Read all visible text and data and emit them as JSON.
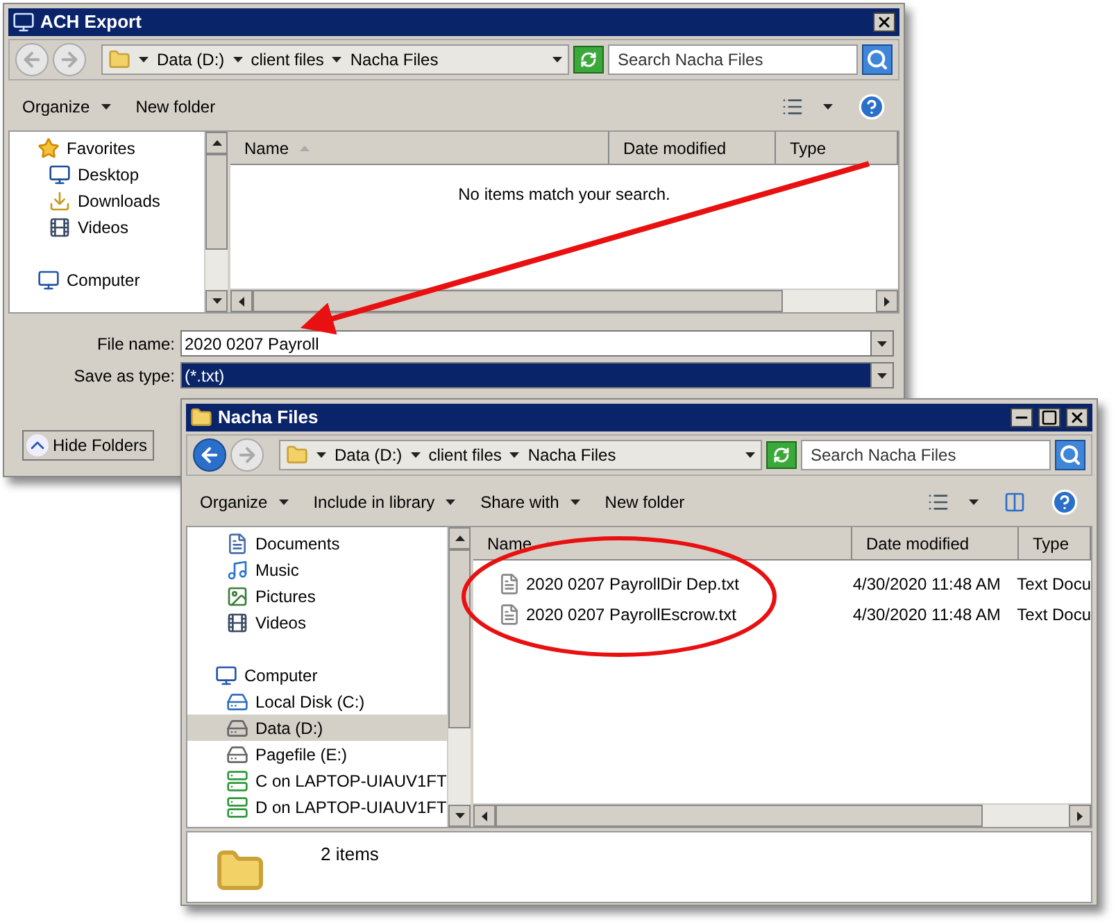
{
  "save_dialog": {
    "title": "ACH Export",
    "title_buttons": [
      {
        "kind": "close"
      }
    ],
    "back_enabled": false,
    "breadcrumb": [
      "Data (D:)",
      "client files",
      "Nacha Files"
    ],
    "search": {
      "placeholder": "Search Nacha Files"
    },
    "toolbar": [
      {
        "label": "Organize",
        "dropdown": true
      },
      {
        "label": "New folder",
        "dropdown": false
      }
    ],
    "view_buttons": [
      {
        "kind": "views"
      },
      {
        "kind": "help"
      }
    ],
    "sidebar": [
      {
        "label": "Favorites",
        "kind": "star",
        "selected": false,
        "children": [
          {
            "label": "Desktop",
            "kind": "desktop",
            "selected": false
          },
          {
            "label": "Downloads",
            "kind": "downloads",
            "selected": false
          },
          {
            "label": "Videos",
            "kind": "video",
            "selected": false
          }
        ]
      },
      {
        "label": "Computer",
        "kind": "computer",
        "selected": false
      }
    ],
    "columns": [
      {
        "label": "Name",
        "sorted": true
      },
      {
        "label": "Date modified",
        "sorted": false
      },
      {
        "label": "Type",
        "sorted": false
      }
    ],
    "empty_message": "No items match your search.",
    "file_name": {
      "label": "File name:",
      "value": "2020 0207 Payroll",
      "highlighted": false
    },
    "save_type": {
      "label": "Save as type:",
      "value": "(*.txt)",
      "highlighted": true
    },
    "hide_folders": "Hide Folders"
  },
  "explorer": {
    "title": "Nacha Files",
    "title_buttons": [
      {
        "kind": "minimize"
      },
      {
        "kind": "maximize"
      },
      {
        "kind": "close"
      }
    ],
    "back_enabled": true,
    "breadcrumb": [
      "Data (D:)",
      "client files",
      "Nacha Files"
    ],
    "search": {
      "placeholder": "Search Nacha Files"
    },
    "toolbar": [
      {
        "label": "Organize",
        "dropdown": true
      },
      {
        "label": "Include in library",
        "dropdown": true
      },
      {
        "label": "Share with",
        "dropdown": true
      },
      {
        "label": "New folder",
        "dropdown": false
      }
    ],
    "view_buttons": [
      {
        "kind": "views"
      },
      {
        "kind": "preview"
      },
      {
        "kind": "help"
      }
    ],
    "sidebar": [
      {
        "label": "Documents",
        "kind": "documents",
        "selected": false
      },
      {
        "label": "Music",
        "kind": "music",
        "selected": false
      },
      {
        "label": "Pictures",
        "kind": "pictures",
        "selected": false
      },
      {
        "label": "Videos",
        "kind": "video",
        "selected": false
      },
      {
        "label": "Computer",
        "kind": "computer",
        "selected": false,
        "children": [
          {
            "label": "Local Disk (C:)",
            "kind": "system_disk",
            "selected": false
          },
          {
            "label": "Data (D:)",
            "kind": "disk",
            "selected": true
          },
          {
            "label": "Pagefile (E:)",
            "kind": "disk",
            "selected": false
          },
          {
            "label": "C on LAPTOP-UIAUV1FT",
            "kind": "network_drive",
            "selected": false
          },
          {
            "label": "D on LAPTOP-UIAUV1FT",
            "kind": "network_drive",
            "selected": false
          }
        ]
      }
    ],
    "columns": [
      {
        "label": "Name",
        "sorted": true
      },
      {
        "label": "Date modified",
        "sorted": false
      },
      {
        "label": "Type",
        "sorted": false
      }
    ],
    "rows": [
      {
        "name": "2020 0207 PayrollDir Dep.txt",
        "date": "4/30/2020 11:48 AM",
        "type": "Text Docu"
      },
      {
        "name": "2020 0207 PayrollEscrow.txt",
        "date": "4/30/2020 11:48 AM",
        "type": "Text Docu"
      }
    ],
    "status": "2 items"
  }
}
